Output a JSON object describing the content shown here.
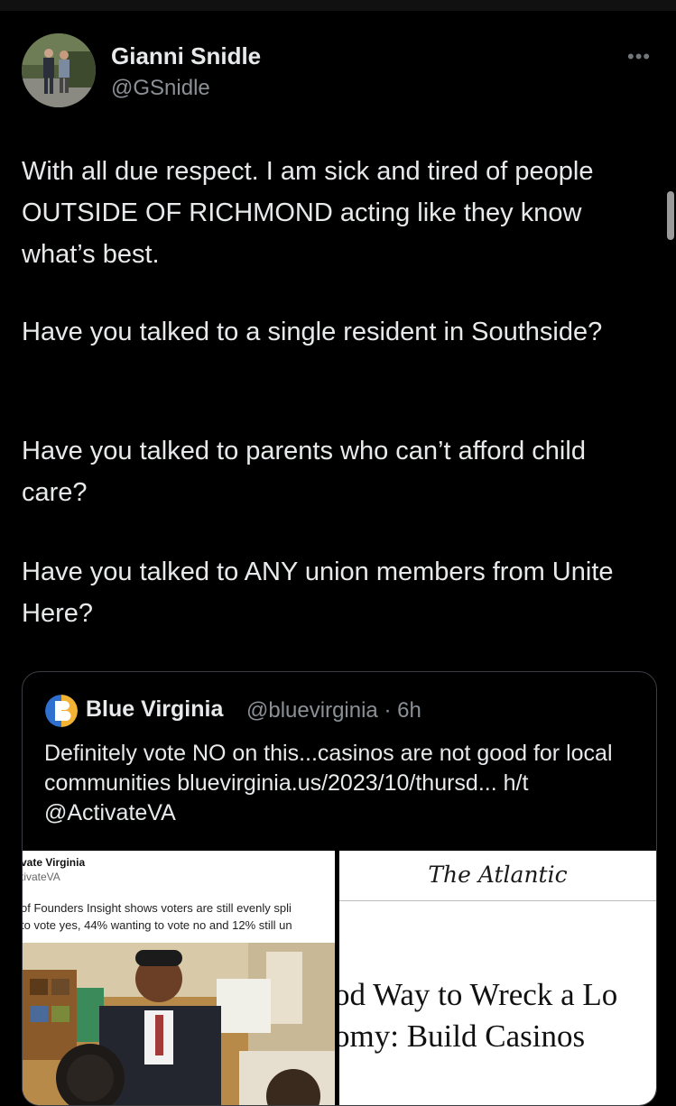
{
  "tweet": {
    "author_name": "Gianni Snidle",
    "author_handle": "@GSnidle",
    "more_label": "•••",
    "paragraphs": [
      "With all due respect. I am sick and tired of people OUTSIDE OF RICHMOND acting like they know what’s best.",
      "Have you talked to a single resident in Southside?",
      "Have you talked to parents who can’t afford child care?",
      "Have you talked to ANY union members from Unite Here?"
    ]
  },
  "quote": {
    "author_name": "Blue Virginia",
    "meta": "@bluevirginia · 6h",
    "text": "Definitely vote NO on this...casinos are not good for local communities bluevirginia.us/2023/10/thursd... h/t @ActivateVA",
    "media_left": {
      "name": "vate Virginia",
      "handle": "tivateVA",
      "line1": "of Founders Insight shows voters are still evenly spli",
      "line2": "to vote yes, 44% wanting to vote no and 12% still un"
    },
    "media_right": {
      "publication": "The Atlantic",
      "headline_line1": "od Way to Wreck a Lo",
      "headline_line2": "omy: Build Casinos"
    }
  },
  "colors": {
    "background": "#000000",
    "text": "#e7e9ea",
    "secondary_text": "#8b9096",
    "border": "#3a3d41"
  }
}
